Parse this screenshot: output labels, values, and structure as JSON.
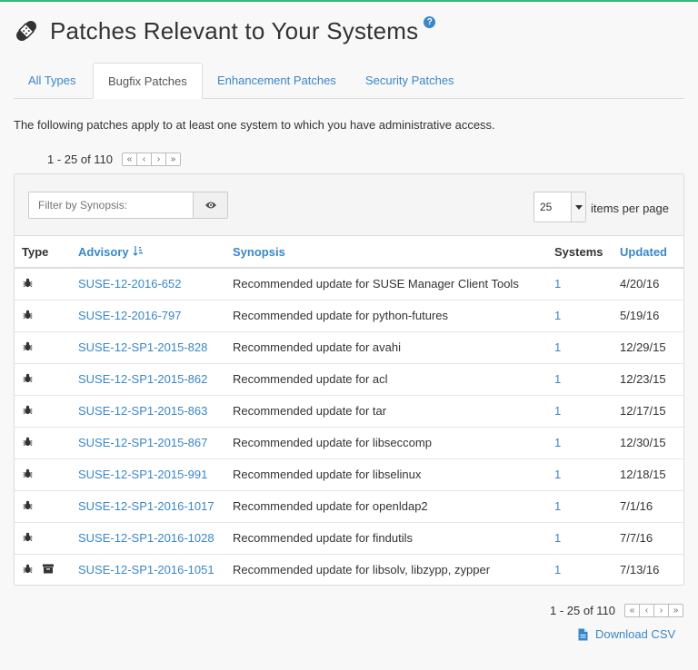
{
  "page": {
    "title": "Patches Relevant to Your Systems",
    "help_glyph": "?",
    "intro": "The following patches apply to at least one system to which you have administrative access."
  },
  "tabs": [
    {
      "label": "All Types",
      "active": false
    },
    {
      "label": "Bugfix Patches",
      "active": true
    },
    {
      "label": "Enhancement Patches",
      "active": false
    },
    {
      "label": "Security Patches",
      "active": false
    }
  ],
  "pager": {
    "range": "1 - 25 of 110",
    "buttons": [
      "«",
      "‹",
      "›",
      "»"
    ]
  },
  "filter": {
    "placeholder": "Filter by Synopsis:",
    "button_icon": "eye-icon"
  },
  "items_per_page": {
    "value": "25",
    "label": "items per page"
  },
  "table": {
    "headers": {
      "type": "Type",
      "advisory": "Advisory",
      "synopsis": "Synopsis",
      "systems": "Systems",
      "updated": "Updated"
    },
    "rows": [
      {
        "icons": [
          "bug-icon"
        ],
        "advisory": "SUSE-12-2016-652",
        "synopsis": "Recommended update for SUSE Manager Client Tools",
        "systems": "1",
        "updated": "4/20/16"
      },
      {
        "icons": [
          "bug-icon"
        ],
        "advisory": "SUSE-12-2016-797",
        "synopsis": "Recommended update for python-futures",
        "systems": "1",
        "updated": "5/19/16"
      },
      {
        "icons": [
          "bug-icon"
        ],
        "advisory": "SUSE-12-SP1-2015-828",
        "synopsis": "Recommended update for avahi",
        "systems": "1",
        "updated": "12/29/15"
      },
      {
        "icons": [
          "bug-icon"
        ],
        "advisory": "SUSE-12-SP1-2015-862",
        "synopsis": "Recommended update for acl",
        "systems": "1",
        "updated": "12/23/15"
      },
      {
        "icons": [
          "bug-icon"
        ],
        "advisory": "SUSE-12-SP1-2015-863",
        "synopsis": "Recommended update for tar",
        "systems": "1",
        "updated": "12/17/15"
      },
      {
        "icons": [
          "bug-icon"
        ],
        "advisory": "SUSE-12-SP1-2015-867",
        "synopsis": "Recommended update for libseccomp",
        "systems": "1",
        "updated": "12/30/15"
      },
      {
        "icons": [
          "bug-icon"
        ],
        "advisory": "SUSE-12-SP1-2015-991",
        "synopsis": "Recommended update for libselinux",
        "systems": "1",
        "updated": "12/18/15"
      },
      {
        "icons": [
          "bug-icon"
        ],
        "advisory": "SUSE-12-SP1-2016-1017",
        "synopsis": "Recommended update for openldap2",
        "systems": "1",
        "updated": "7/1/16"
      },
      {
        "icons": [
          "bug-icon"
        ],
        "advisory": "SUSE-12-SP1-2016-1028",
        "synopsis": "Recommended update for findutils",
        "systems": "1",
        "updated": "7/7/16"
      },
      {
        "icons": [
          "bug-icon",
          "archive-icon"
        ],
        "advisory": "SUSE-12-SP1-2016-1051",
        "synopsis": "Recommended update for libsolv, libzypp, zypper",
        "systems": "1",
        "updated": "7/13/16"
      }
    ]
  },
  "download": {
    "label": "Download CSV"
  },
  "colors": {
    "accent": "#3a87c8",
    "brand_green": "#30ba78"
  }
}
